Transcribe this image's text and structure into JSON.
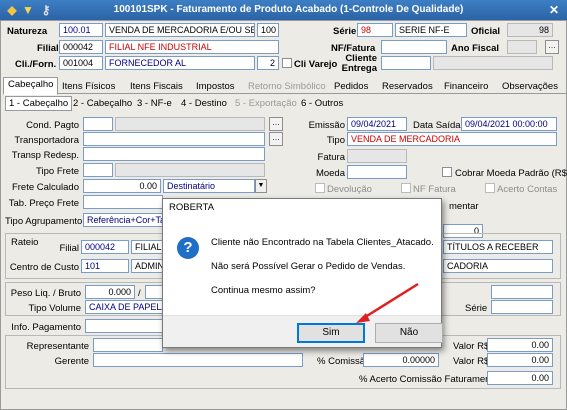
{
  "window": {
    "title": "100101SPK - Faturamento de Produto Acabado (1-Controle De Qualidade)"
  },
  "header": {
    "natureza_label": "Natureza",
    "natureza_code": "100.01",
    "natureza_desc": "VENDA DE MERCADORIA E/OU SERVI",
    "natureza_num": "100",
    "filial_label": "Filial",
    "filial_code": "000042",
    "filial_desc": "FILIAL NFE INDUSTRIAL",
    "cliforn_label": "Cli./Forn.",
    "cliforn_code": "001004",
    "cliforn_desc": "FORNECEDOR AL",
    "cliforn_num": "2",
    "clivarejo_label": "Cli Varejo",
    "serie_label": "Série",
    "serie_code": "98",
    "serie_desc": "SERIE NF-E",
    "oficial_label": "Oficial",
    "oficial_value": "98",
    "nffatura_label": "NF/Fatura",
    "anofiscal_label": "Ano Fiscal",
    "cliente_entrega_label1": "Cliente",
    "cliente_entrega_label2": "Entrega"
  },
  "tabs": [
    {
      "label": "Cabeçalho",
      "state": "active"
    },
    {
      "label": "Itens Físicos",
      "state": "normal"
    },
    {
      "label": "Itens Fiscais",
      "state": "normal"
    },
    {
      "label": "Impostos",
      "state": "normal"
    },
    {
      "label": "Retorno Simbólico",
      "state": "disabled"
    },
    {
      "label": "Pedidos",
      "state": "normal"
    },
    {
      "label": "Reservados",
      "state": "normal"
    },
    {
      "label": "Financeiro",
      "state": "normal"
    },
    {
      "label": "Observações",
      "state": "normal"
    }
  ],
  "subtabs": [
    {
      "label": "1 - Cabeçalho",
      "state": "active"
    },
    {
      "label": "2 - Cabeçalho",
      "state": "normal"
    },
    {
      "label": "3 - NF-e",
      "state": "normal"
    },
    {
      "label": "4 - Destino",
      "state": "normal"
    },
    {
      "label": "5 - Exportação",
      "state": "disabled"
    },
    {
      "label": "6 - Outros",
      "state": "normal"
    }
  ],
  "form": {
    "cond_pagto_label": "Cond. Pagto",
    "transportadora_label": "Transportadora",
    "transp_redesp_label": "Transp Redesp.",
    "tipo_frete_label": "Tipo Frete",
    "frete_calculado_label": "Frete Calculado",
    "frete_calculado_value": "0.00",
    "frete_dest": "Destinatário",
    "tab_preco_frete_label": "Tab. Preço Frete",
    "tipo_agrupamento_label": "Tipo Agrupamento",
    "tipo_agrupamento_value": "Referência+Cor+Ta",
    "emissao_label": "Emissão",
    "emissao_value": "09/04/2021",
    "data_saida_label": "Data Saída",
    "data_saida_value": "09/04/2021 00:00:00",
    "tipo_label": "Tipo",
    "tipo_value": "VENDA DE MERCADORIA",
    "fatura_label": "Fatura",
    "moeda_label": "Moeda",
    "cobrar_moeda_label": "Cobrar Moeda Padrão (R$)",
    "devolucao_label": "Devolução",
    "nf_fatura_label": "NF Fatura",
    "acerto_contas_label": "Acerto Contas",
    "complementar_label": "mentar",
    "zero_value": "0"
  },
  "rateio": {
    "title": "Rateio",
    "filial_label": "Filial",
    "filial_code": "000042",
    "filial_desc": "FILIAL",
    "centro_custo_label": "Centro de Custo",
    "centro_custo_code": "101",
    "centro_custo_desc": "ADMIN",
    "right_1": "TÍTULOS A RECEBER",
    "right_2": "CADORIA"
  },
  "peso": {
    "peso_label": "Peso Liq. / Bruto",
    "peso_liq": "0.000",
    "tipo_volume_label": "Tipo Volume",
    "tipo_volume_value": "CAIXA DE PAPELAO",
    "serie_label": "Série",
    "info_pagamento_label": "Info. Pagamento"
  },
  "comissao": {
    "representante_label": "Representante",
    "gerente_label": "Gerente",
    "pct_comissao_label": "% Comissão",
    "pct_comissao_value": "0.00000",
    "valor_rs_label": "Valor R$",
    "valor_rs_1": "0.00",
    "valor_rs_2": "0.00",
    "valor_rs_3": "0.00",
    "pct_acerto_label": "% Acerto Comissão Faturamento"
  },
  "dialog": {
    "title": "ROBERTA",
    "line1": "Cliente não Encontrado na Tabela Clientes_Atacado.",
    "line2": "Não será Possível Gerar o Pedido de Vendas.",
    "line3": "Continua mesmo assim?",
    "yes": "Sim",
    "no": "Não"
  },
  "colors": {
    "titlebar": "#2b63a6",
    "arrow": "#e02020",
    "field_text_red": "#cc0000",
    "dialog_default_border": "#0078d7"
  }
}
